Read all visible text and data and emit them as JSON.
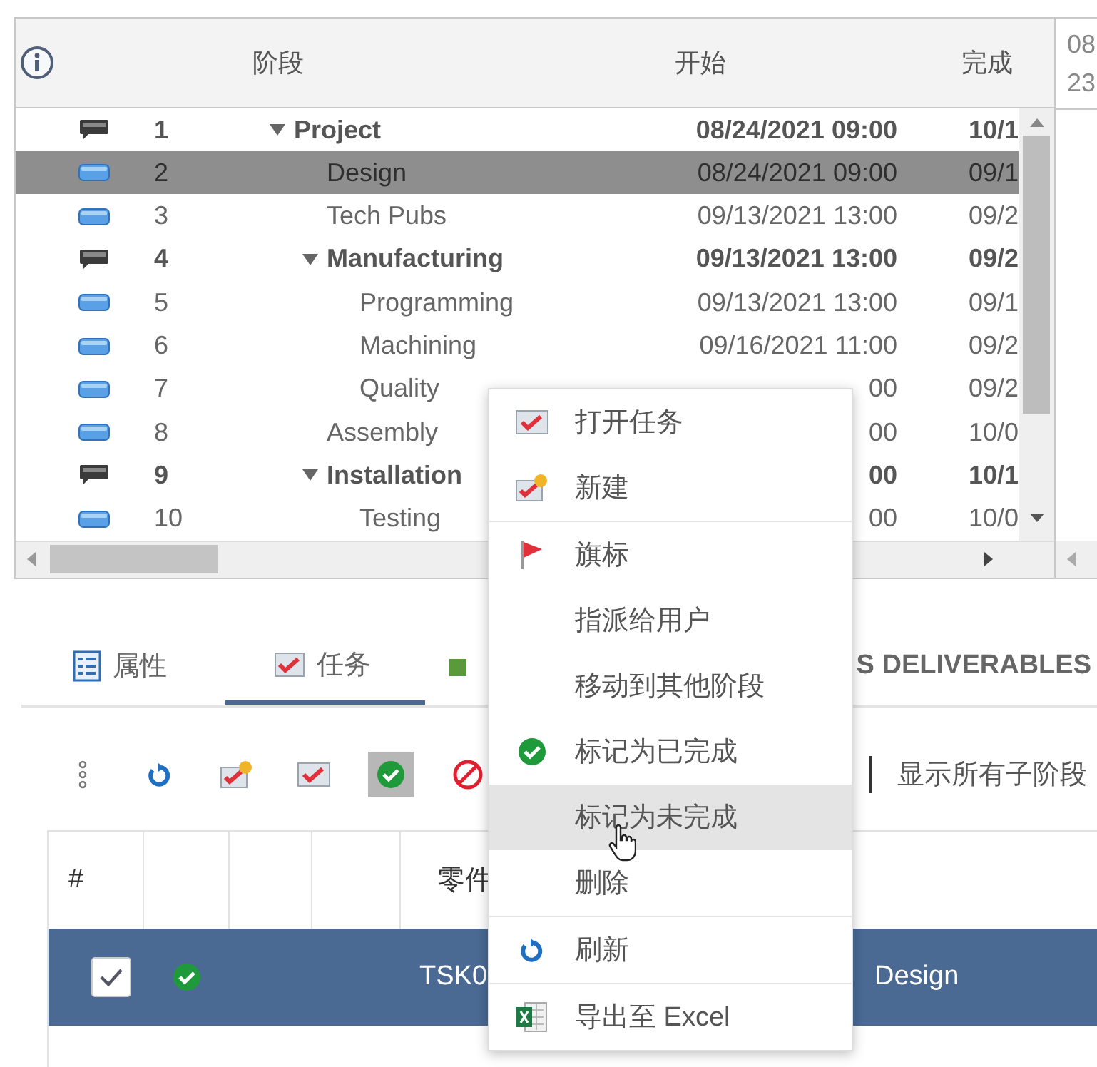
{
  "grid": {
    "columns": [
      "阶段",
      "开始",
      "完成"
    ],
    "rows": [
      {
        "num": "1",
        "name": "Project",
        "kind": "summary",
        "expanded": true,
        "selected": false,
        "start": "08/24/2021 09:00",
        "finish": "10/1",
        "children": [
          {
            "num": "2",
            "name": "Design",
            "kind": "task",
            "selected": true,
            "start": "08/24/2021 09:00",
            "finish": "09/1"
          },
          {
            "num": "3",
            "name": "Tech Pubs",
            "kind": "task",
            "selected": false,
            "start": "09/13/2021 13:00",
            "finish": "09/2"
          },
          {
            "num": "4",
            "name": "Manufacturing",
            "kind": "summary",
            "expanded": true,
            "selected": false,
            "start": "09/13/2021 13:00",
            "finish": "09/2",
            "children": [
              {
                "num": "5",
                "name": "Programming",
                "kind": "task",
                "selected": false,
                "start": "09/13/2021 13:00",
                "finish": "09/1"
              },
              {
                "num": "6",
                "name": "Machining",
                "kind": "task",
                "selected": false,
                "start": "09/16/2021 11:00",
                "finish": "09/2"
              },
              {
                "num": "7",
                "name": "Quality",
                "kind": "task",
                "selected": false,
                "start": "00",
                "finish": "09/2"
              }
            ]
          },
          {
            "num": "8",
            "name": "Assembly",
            "kind": "task",
            "selected": false,
            "start": "00",
            "finish": "10/0"
          },
          {
            "num": "9",
            "name": "Installation",
            "kind": "summary",
            "expanded": true,
            "selected": false,
            "start": "00",
            "finish": "10/1",
            "children": [
              {
                "num": "10",
                "name": "Testing",
                "kind": "task",
                "selected": false,
                "start": "00",
                "finish": "10/0"
              }
            ]
          }
        ]
      }
    ]
  },
  "timeline": {
    "lines": [
      "08",
      "23"
    ]
  },
  "tabs": [
    {
      "label": "属性",
      "kind": "properties",
      "selected": false
    },
    {
      "label": "任务",
      "kind": "tasks",
      "selected": true
    },
    {
      "label": "S DELIVERABLES",
      "kind": "deliverables",
      "selected": false
    }
  ],
  "toolbar": {
    "buttons": [
      {
        "kind": "more",
        "pressed": false
      },
      {
        "kind": "refresh",
        "pressed": false
      },
      {
        "kind": "new",
        "pressed": false
      },
      {
        "kind": "open",
        "pressed": false
      },
      {
        "kind": "complete",
        "pressed": true
      },
      {
        "kind": "cancel",
        "pressed": false
      }
    ],
    "label": "显示所有子阶段"
  },
  "tasks": {
    "columns": [
      "#",
      "",
      "",
      "",
      "零件"
    ],
    "rows": [
      {
        "checked": true,
        "selected": true,
        "complete": true,
        "id": "TSK0",
        "name": "Design"
      }
    ]
  },
  "context_menu": {
    "groups": [
      [
        {
          "label": "打开任务",
          "kind": "open",
          "hovered": false
        },
        {
          "label": "新建",
          "kind": "new",
          "hovered": false
        }
      ],
      [
        {
          "label": "旗标",
          "kind": "flag",
          "hovered": false
        },
        {
          "label": "指派给用户",
          "kind": "plain",
          "hovered": false
        },
        {
          "label": "移动到其他阶段",
          "kind": "plain",
          "hovered": false
        },
        {
          "label": "标记为已完成",
          "kind": "complete",
          "hovered": false
        },
        {
          "label": "标记为未完成",
          "kind": "plain",
          "hovered": true
        },
        {
          "label": "删除",
          "kind": "plain",
          "hovered": false
        }
      ],
      [
        {
          "label": "刷新",
          "kind": "refresh",
          "hovered": false
        }
      ],
      [
        {
          "label": "导出至 Excel",
          "kind": "excel",
          "hovered": false
        }
      ]
    ]
  }
}
